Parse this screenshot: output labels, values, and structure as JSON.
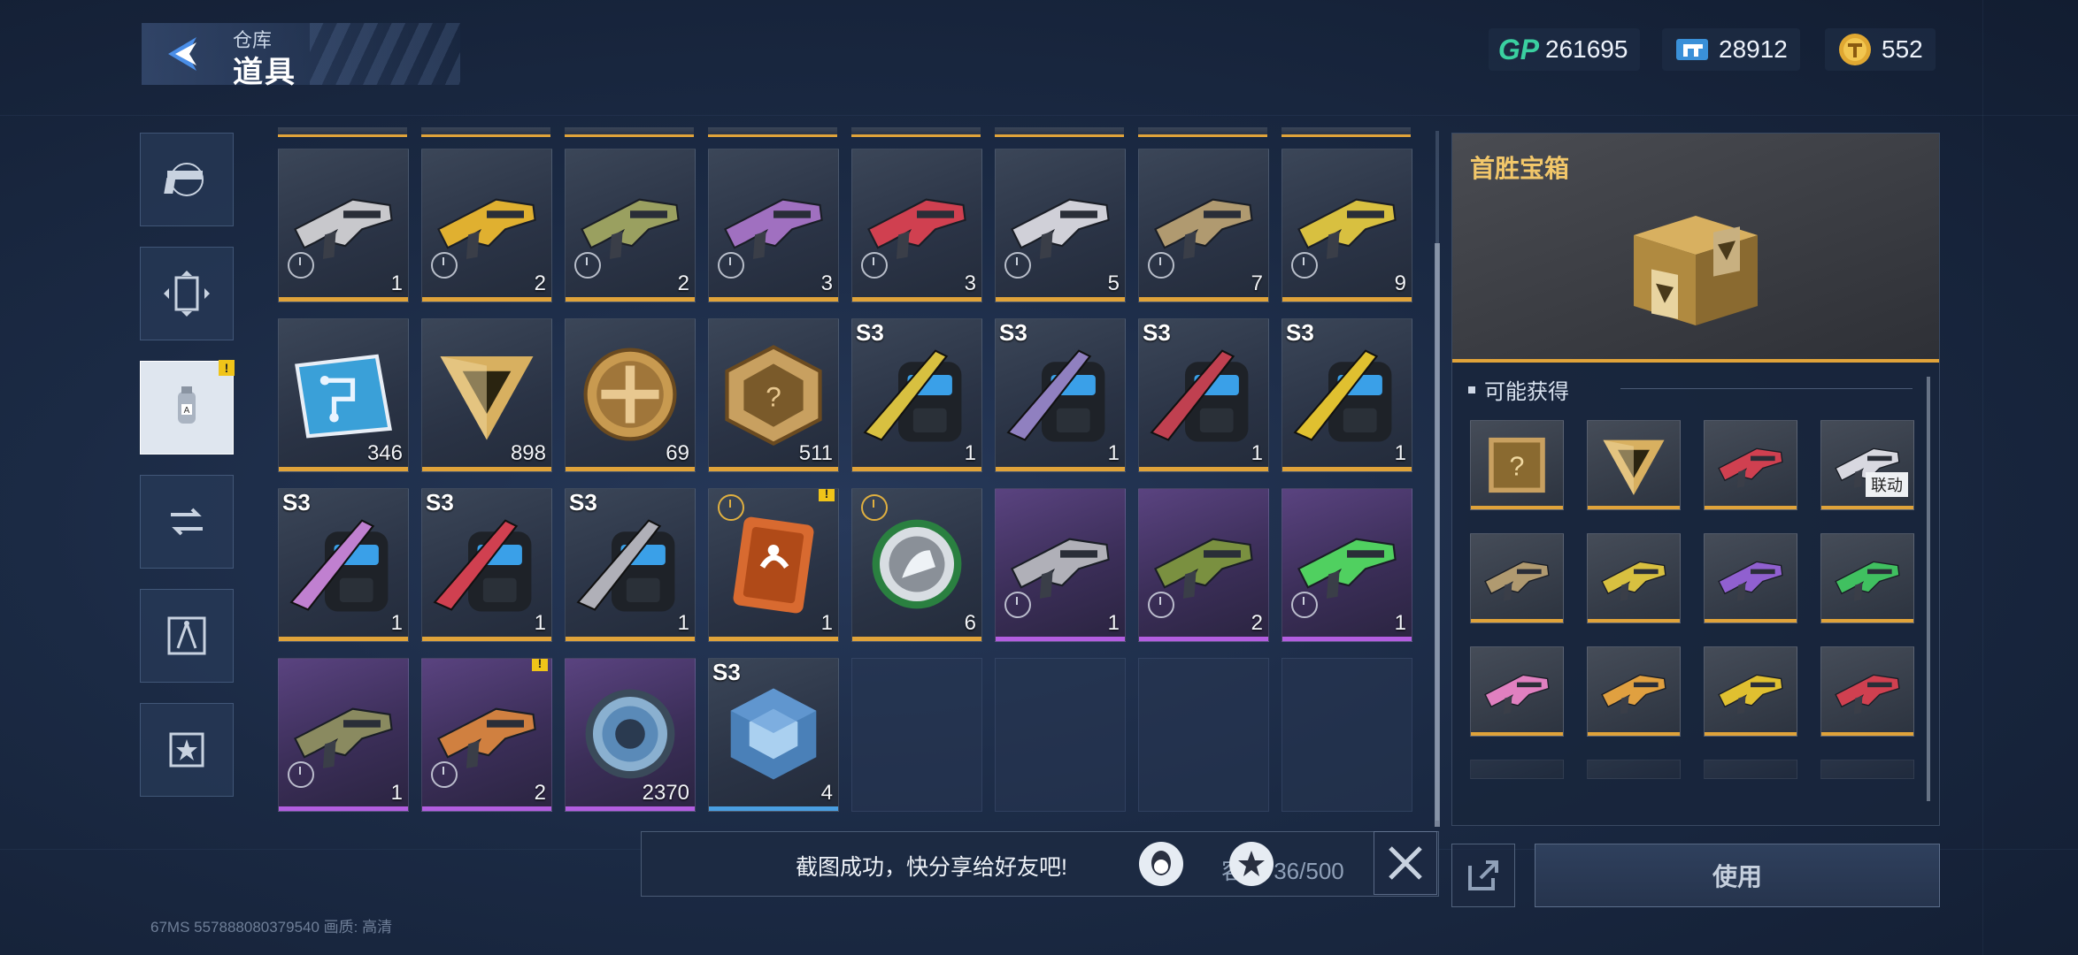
{
  "header": {
    "sub_title": "仓库",
    "title": "道具"
  },
  "currencies": [
    {
      "icon": "gp-icon",
      "label": "GP",
      "value": "261695"
    },
    {
      "icon": "ticket-icon",
      "value": "28912"
    },
    {
      "icon": "gold-coin-icon",
      "value": "552"
    }
  ],
  "sidebar": {
    "tabs": [
      {
        "name": "weapon-tab",
        "icon": "pistol-icon"
      },
      {
        "name": "card-tab",
        "icon": "card-icon"
      },
      {
        "name": "item-tab",
        "icon": "canister-icon",
        "active": true,
        "alert": "!"
      },
      {
        "name": "exchange-tab",
        "icon": "exchange-icon"
      },
      {
        "name": "blueprint-tab",
        "icon": "compass-icon"
      },
      {
        "name": "badge-tab",
        "icon": "star-badge-icon"
      }
    ]
  },
  "grid": {
    "items": [
      {
        "type": "weapon",
        "qty": "1",
        "color": "#c8c8cc",
        "rarity": "gold",
        "clock": true
      },
      {
        "type": "weapon",
        "qty": "2",
        "color": "#e0b030",
        "rarity": "gold",
        "clock": true
      },
      {
        "type": "weapon",
        "qty": "2",
        "color": "#9aa060",
        "rarity": "gold",
        "clock": true
      },
      {
        "type": "weapon",
        "qty": "3",
        "color": "#a070c0",
        "rarity": "gold",
        "clock": true
      },
      {
        "type": "weapon",
        "qty": "3",
        "color": "#d04050",
        "rarity": "gold",
        "clock": true
      },
      {
        "type": "weapon",
        "qty": "5",
        "color": "#d0d0d8",
        "rarity": "gold",
        "clock": true
      },
      {
        "type": "weapon",
        "qty": "7",
        "color": "#b09a70",
        "rarity": "gold",
        "clock": true
      },
      {
        "type": "weapon",
        "qty": "9",
        "color": "#d8c040",
        "rarity": "gold",
        "clock": true
      },
      {
        "type": "chip",
        "qty": "346",
        "color": "#3aa0d8",
        "rarity": "gold"
      },
      {
        "type": "triangle",
        "qty": "898",
        "color": "#d8b060",
        "rarity": "gold"
      },
      {
        "type": "medal",
        "qty": "69",
        "color": "#c89a50",
        "rarity": "gold"
      },
      {
        "type": "hexmedal",
        "qty": "511",
        "color": "#c8a060",
        "rarity": "gold"
      },
      {
        "type": "backpack",
        "qty": "1",
        "season": "S3",
        "color": "#d8c040",
        "rarity": "gold"
      },
      {
        "type": "backpack",
        "qty": "1",
        "season": "S3",
        "color": "#9080c0",
        "rarity": "gold"
      },
      {
        "type": "backpack",
        "qty": "1",
        "season": "S3",
        "color": "#c04050",
        "rarity": "gold"
      },
      {
        "type": "backpack",
        "qty": "1",
        "season": "S3",
        "color": "#e0c030",
        "rarity": "gold"
      },
      {
        "type": "backpack",
        "qty": "1",
        "season": "S3",
        "color": "#c080d0",
        "rarity": "gold"
      },
      {
        "type": "backpack",
        "qty": "1",
        "season": "S3",
        "color": "#d04050",
        "rarity": "gold"
      },
      {
        "type": "backpack",
        "qty": "1",
        "season": "S3",
        "color": "#b0b0b8",
        "rarity": "gold"
      },
      {
        "type": "card",
        "qty": "1",
        "color": "#d86a30",
        "rarity": "gold",
        "clock_top": true,
        "alert": "!"
      },
      {
        "type": "emblem",
        "qty": "6",
        "color": "#8a9098",
        "rarity": "gold",
        "clock_top": true
      },
      {
        "type": "weapon",
        "qty": "1",
        "color": "#b0b0b8",
        "rarity": "purple",
        "clock": true
      },
      {
        "type": "weapon",
        "qty": "2",
        "color": "#7a9040",
        "rarity": "purple",
        "clock": true
      },
      {
        "type": "weapon",
        "qty": "1",
        "color": "#50d060",
        "rarity": "purple",
        "clock": true
      },
      {
        "type": "weapon",
        "qty": "1",
        "color": "#8a8a60",
        "rarity": "purple",
        "clock": true
      },
      {
        "type": "weapon",
        "qty": "2",
        "color": "#d08040",
        "rarity": "purple",
        "clock": true,
        "alert": "!"
      },
      {
        "type": "disc",
        "qty": "2370",
        "color": "#5a8ab8",
        "rarity": "purple"
      },
      {
        "type": "cube",
        "qty": "4",
        "season": "S3",
        "color": "#4a80b8",
        "rarity": "blue"
      },
      {
        "type": "empty"
      },
      {
        "type": "empty"
      },
      {
        "type": "empty"
      },
      {
        "type": "empty"
      }
    ]
  },
  "detail": {
    "title": "首胜宝箱",
    "drops_heading": "可能获得",
    "drops": [
      {
        "type": "random-weapon",
        "color": "#d8b060"
      },
      {
        "type": "triangle",
        "color": "#d8b060"
      },
      {
        "type": "weapon",
        "color": "#d04050"
      },
      {
        "type": "weapon",
        "color": "#d8d8e0",
        "tag": "联动"
      },
      {
        "type": "weapon",
        "color": "#b09a70"
      },
      {
        "type": "weapon",
        "color": "#d8c040"
      },
      {
        "type": "weapon",
        "color": "#9060d0"
      },
      {
        "type": "weapon",
        "color": "#40c060"
      },
      {
        "type": "weapon",
        "color": "#e080c0"
      },
      {
        "type": "weapon",
        "color": "#e0a040"
      },
      {
        "type": "weapon",
        "color": "#e0c030"
      },
      {
        "type": "weapon",
        "color": "#d04050"
      }
    ]
  },
  "bottom": {
    "toast_text": "截图成功，快分享给好友吧!",
    "capacity": "容量 36/500",
    "use_label": "使用",
    "footer": "67MS  557888080379540        画质: 高清"
  },
  "colors": {
    "gold_rarity": "#e0a33a",
    "purple_rarity": "#b35ee0",
    "blue_rarity": "#4a9ee0",
    "detail_title": "#f2c76a"
  }
}
